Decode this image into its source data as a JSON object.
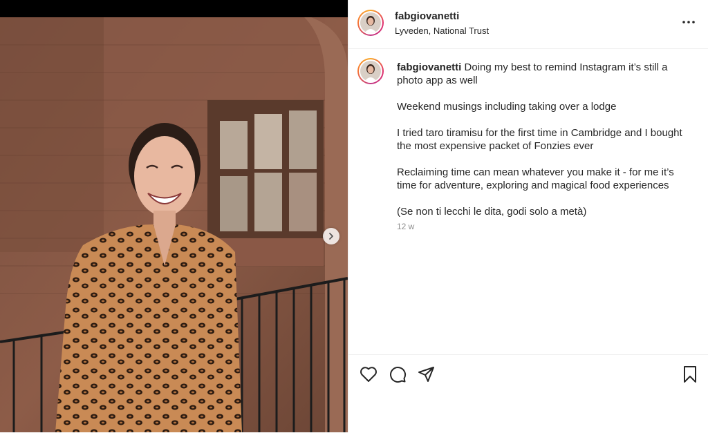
{
  "post": {
    "author": {
      "username": "fabgiovanetti",
      "location": "Lyveden, National Trust",
      "avatar": "profile-photo"
    },
    "photo": {
      "description_icon": "post-photo",
      "next_icon": "chevron-right-icon"
    },
    "caption": {
      "username": "fabgiovanetti",
      "first_line": "Doing my best to remind Instagram it’s still a photo app as well",
      "paragraphs": [
        "Weekend musings including taking over a lodge",
        "I tried taro tiramisu for the first time in Cambridge and I bought the most expensive packet of Fonzies ever",
        "Reclaiming time can mean whatever you make it - for me it’s time for adventure, exploring and magical food experiences",
        "(Se non ti lecchi le dita, godi solo a metà)"
      ],
      "timestamp": "12 w"
    },
    "actions": {
      "like_icon": "heart-icon",
      "comment_icon": "comment-icon",
      "share_icon": "send-icon",
      "save_icon": "bookmark-icon",
      "more_icon": "more-horizontal-icon"
    }
  },
  "colors": {
    "text": "#262626",
    "muted": "#8e8e8e",
    "border": "#efefef",
    "ring_start": "#f9a825",
    "ring_end": "#c13584"
  }
}
